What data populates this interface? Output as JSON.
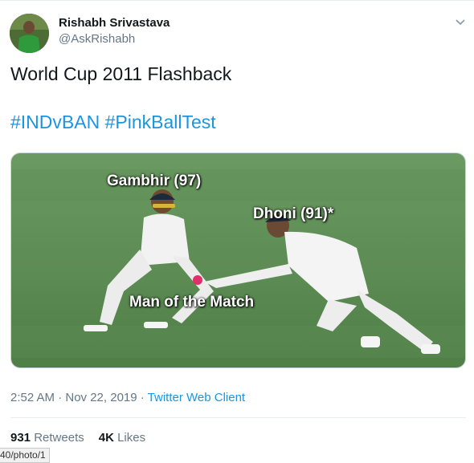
{
  "tweet": {
    "author_name": "Rishabh Srivastava",
    "author_handle": "@AskRishabh",
    "text": "World Cup 2011 Flashback",
    "hashtags": [
      "#INDvBAN",
      "#PinkBallTest"
    ],
    "timestamp": "2:52 AM · Nov 22, 2019",
    "separator": " · ",
    "client": "Twitter Web Client",
    "retweets_count": "931",
    "retweets_label": "Retweets",
    "likes_count": "4K",
    "likes_label": "Likes"
  },
  "media": {
    "label_top_left": "Gambhir (97)",
    "label_top_right": "Dhoni (91)*",
    "label_bottom": "Man of the Match"
  },
  "statusbar": {
    "text": "40/photo/1"
  },
  "icons": {
    "menu": "chevron-down-icon",
    "avatar": "avatar"
  },
  "colors": {
    "link": "#1b95e0",
    "muted": "#657786",
    "field": "#5f8f57"
  }
}
